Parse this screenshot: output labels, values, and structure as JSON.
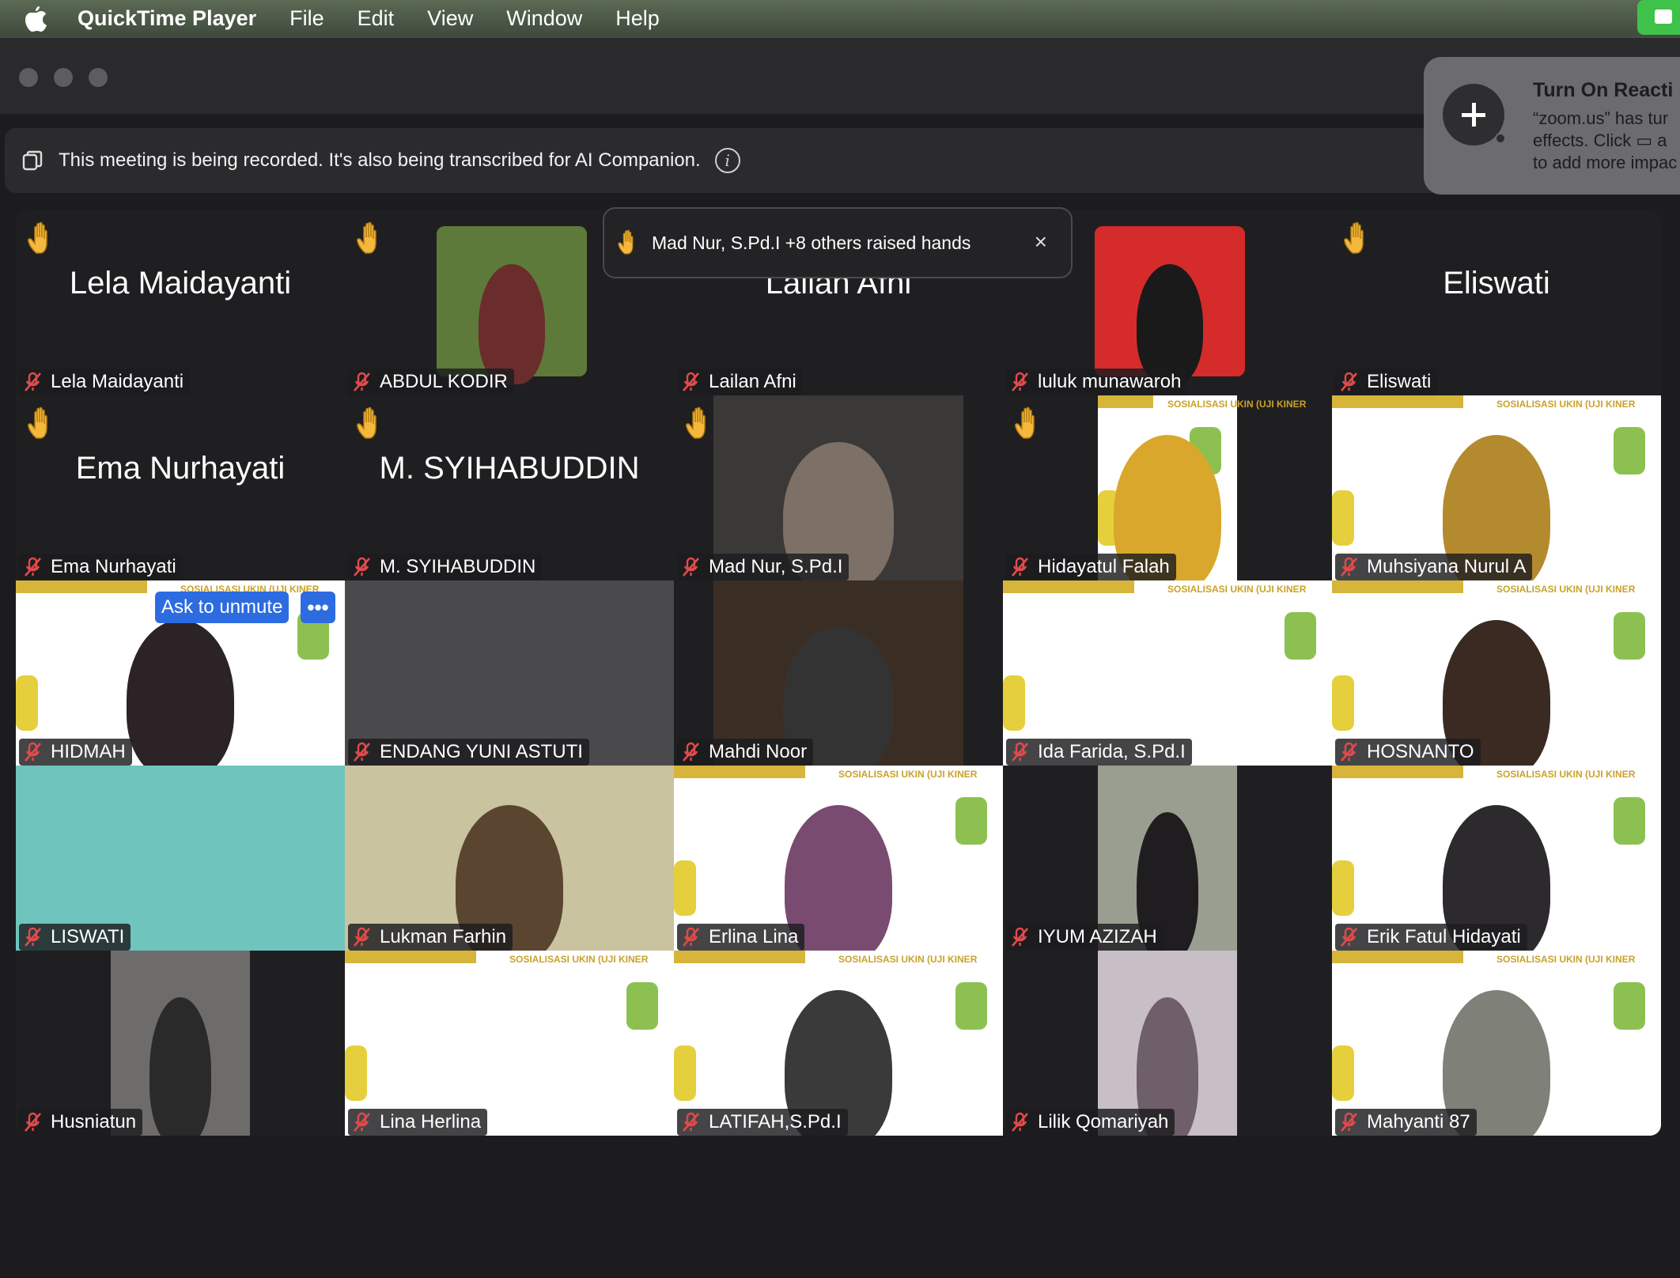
{
  "menubar": {
    "app_name": "QuickTime Player",
    "items": [
      "File",
      "Edit",
      "View",
      "Window",
      "Help"
    ]
  },
  "banner": {
    "text": "This meeting is being recorded. It's also being transcribed for AI Companion.",
    "info_glyph": "i"
  },
  "notification": {
    "title": "Turn On Reacti",
    "body": "“zoom.us” has tur\neffects. Click ▭ a\nto add more impac"
  },
  "raised_hands": {
    "text": "Mad Nur, S.Pd.I  +8 others raised hands",
    "close": "×"
  },
  "unmute": {
    "ask_label": "Ask to unmute",
    "more_label": "•••"
  },
  "participants": [
    {
      "name": "Lela Maidayanti",
      "big": "Lela Maidayanti",
      "hand": true
    },
    {
      "name": "ABDUL KODIR",
      "big": "",
      "hand": true
    },
    {
      "name": "Lailan Afni",
      "big": "Lailan Afni",
      "hand": false
    },
    {
      "name": "luluk munawaroh",
      "big": "",
      "hand": false
    },
    {
      "name": "Eliswati",
      "big": "Eliswati",
      "hand": true
    },
    {
      "name": "Ema Nurhayati",
      "big": "Ema Nurhayati",
      "hand": true
    },
    {
      "name": "M. SYIHABUDDIN",
      "big": "M. SYIHABUDDIN",
      "hand": true
    },
    {
      "name": "Mad Nur, S.Pd.I",
      "big": "",
      "hand": true
    },
    {
      "name": "Hidayatul Falah",
      "big": "",
      "hand": true
    },
    {
      "name": "Muhsiyana Nurul A",
      "big": "",
      "hand": false
    },
    {
      "name": "HIDMAH",
      "big": "",
      "hand": false
    },
    {
      "name": "ENDANG YUNI ASTUTI",
      "big": "",
      "hand": false
    },
    {
      "name": "Mahdi Noor",
      "big": "",
      "hand": false
    },
    {
      "name": "Ida Farida, S.Pd.I",
      "big": "",
      "hand": false
    },
    {
      "name": "HOSNANTO",
      "big": "",
      "hand": false
    },
    {
      "name": "LISWATI",
      "big": "",
      "hand": false
    },
    {
      "name": "Lukman Farhin",
      "big": "",
      "hand": false
    },
    {
      "name": "Erlina Lina",
      "big": "",
      "hand": false
    },
    {
      "name": "IYUM AZIZAH",
      "big": "",
      "hand": false
    },
    {
      "name": "Erik Fatul Hidayati",
      "big": "",
      "hand": false
    },
    {
      "name": "Husniatun",
      "big": "",
      "hand": false
    },
    {
      "name": "Lina Herlina",
      "big": "",
      "hand": false
    },
    {
      "name": "LATIFAH,S.Pd.I",
      "big": "",
      "hand": false
    },
    {
      "name": "Lilik Qomariyah",
      "big": "",
      "hand": false
    },
    {
      "name": "Mahyanti 87",
      "big": "",
      "hand": false
    }
  ],
  "slide_header": "SOSIALISASI UKIN (UJI KINER"
}
